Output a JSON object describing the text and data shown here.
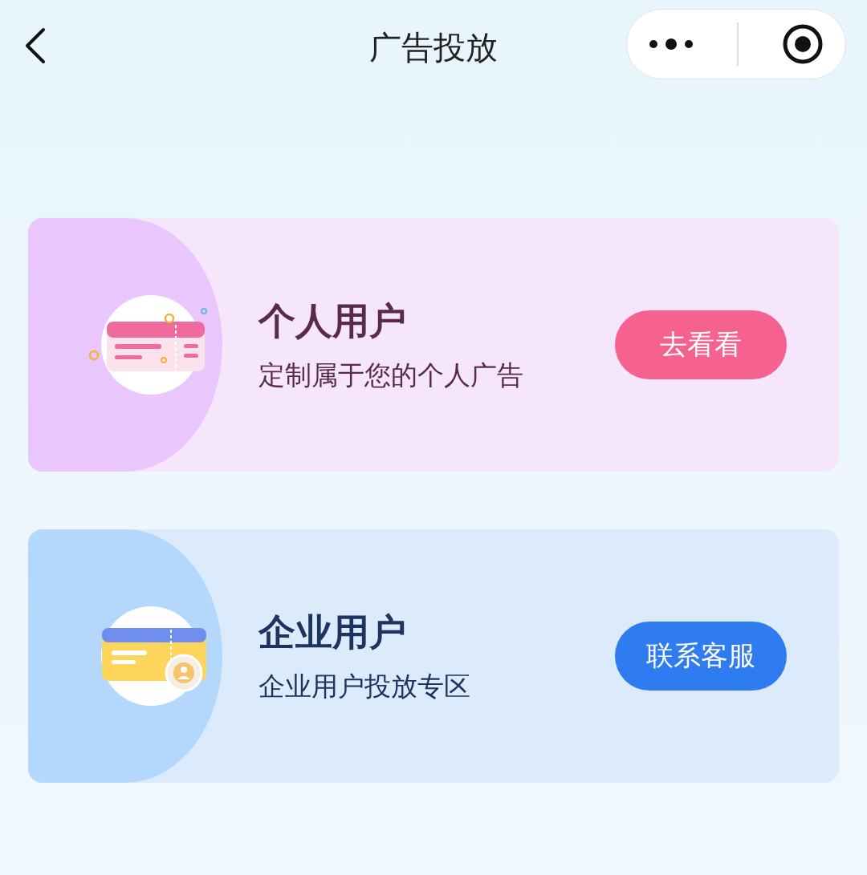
{
  "header": {
    "title": "广告投放"
  },
  "cards": [
    {
      "kind": "personal",
      "title": "个人用户",
      "subtitle": "定制属于您的个人广告",
      "button": "去看看"
    },
    {
      "kind": "enterprise",
      "title": "企业用户",
      "subtitle": "企业用户投放专区",
      "button": "联系客服"
    }
  ]
}
